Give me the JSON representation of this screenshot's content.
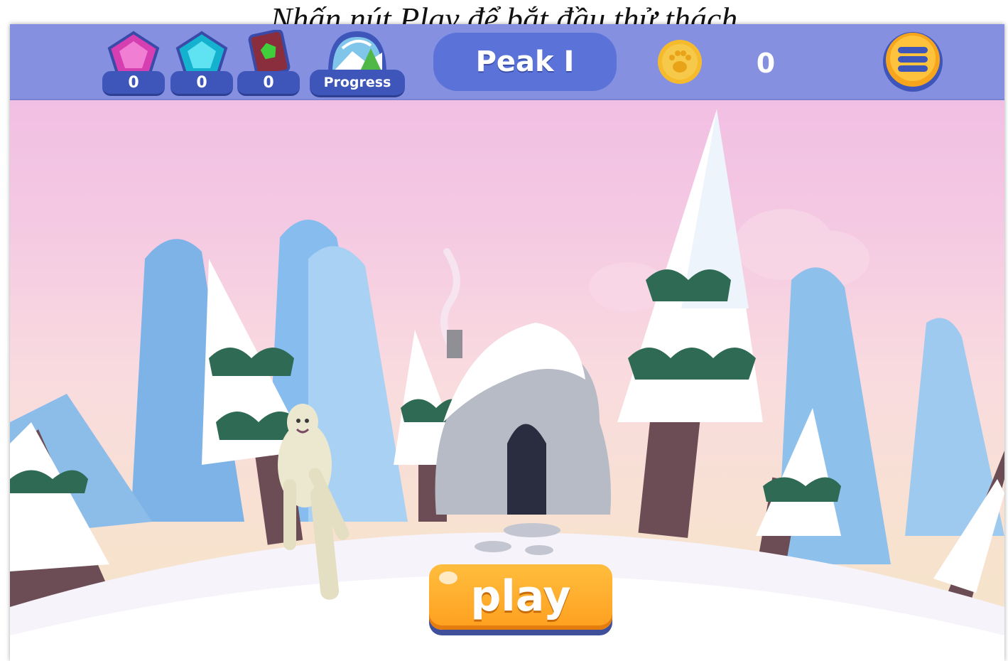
{
  "caption": "Nhấn nút Play để bắt đầu thử thách",
  "hud": {
    "pink_gems": "0",
    "blue_gems": "0",
    "books": "0",
    "progress_label": "Progress",
    "peak_label": "Peak I",
    "coins": "0"
  },
  "play_label": "play",
  "colors": {
    "topbar": "#8590e0",
    "pill": "#3e55b9",
    "peak_pill": "#5b73d8",
    "play_button": "#ffa829",
    "menu_button": "#f7a51d",
    "coin": "#f5bb2c"
  },
  "icons": [
    "pink-gem-icon",
    "blue-gem-icon",
    "spellbook-icon",
    "progress-map-icon",
    "paw-coin-icon",
    "hamburger-menu-icon"
  ]
}
